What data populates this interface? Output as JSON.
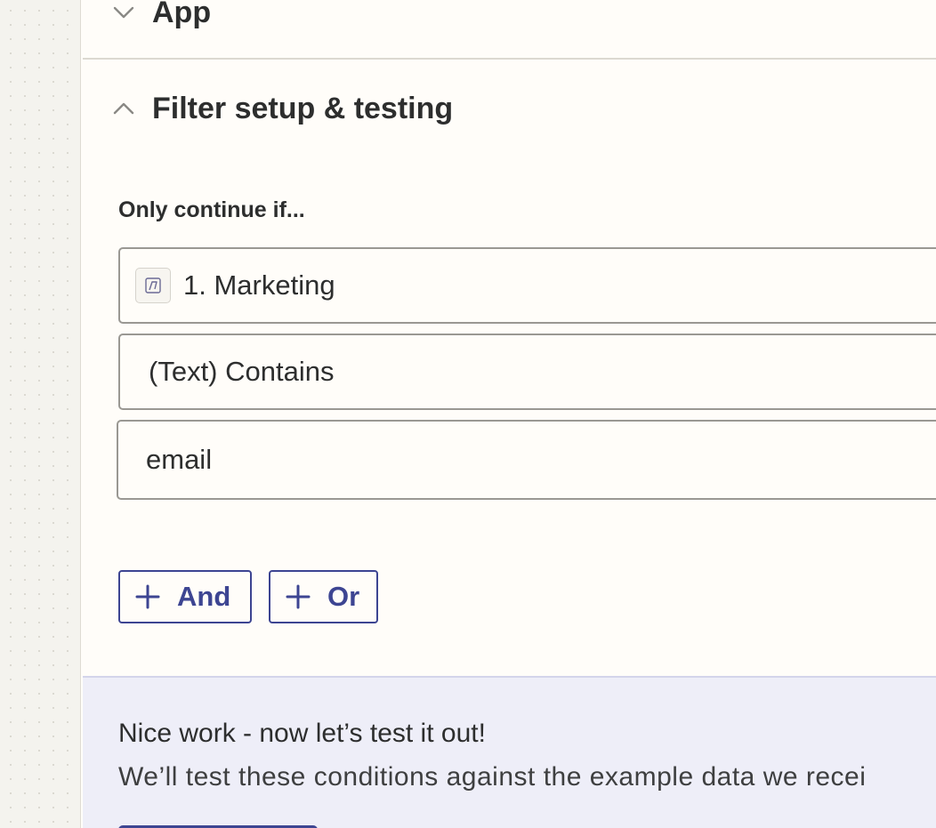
{
  "sections": {
    "app": {
      "title": "App",
      "expanded": false
    },
    "filter": {
      "title": "Filter setup & testing",
      "expanded": true
    }
  },
  "filter": {
    "label": "Only continue if...",
    "field_value": "1. Marketing",
    "condition": "(Text) Contains",
    "value": "email",
    "and_label": "And",
    "or_label": "Or"
  },
  "test": {
    "title": "Nice work - now let’s test it out!",
    "description": "We’ll test these conditions against the example data we recei"
  },
  "colors": {
    "accent": "#3d4592",
    "test_bg": "#eeeef8",
    "panel_bg": "#fffdf9"
  },
  "icons": {
    "app_collapsed": "chevron-down-icon",
    "filter_expanded": "chevron-up-icon",
    "app_badge": "app-logo-icon",
    "add": "plus-icon"
  }
}
